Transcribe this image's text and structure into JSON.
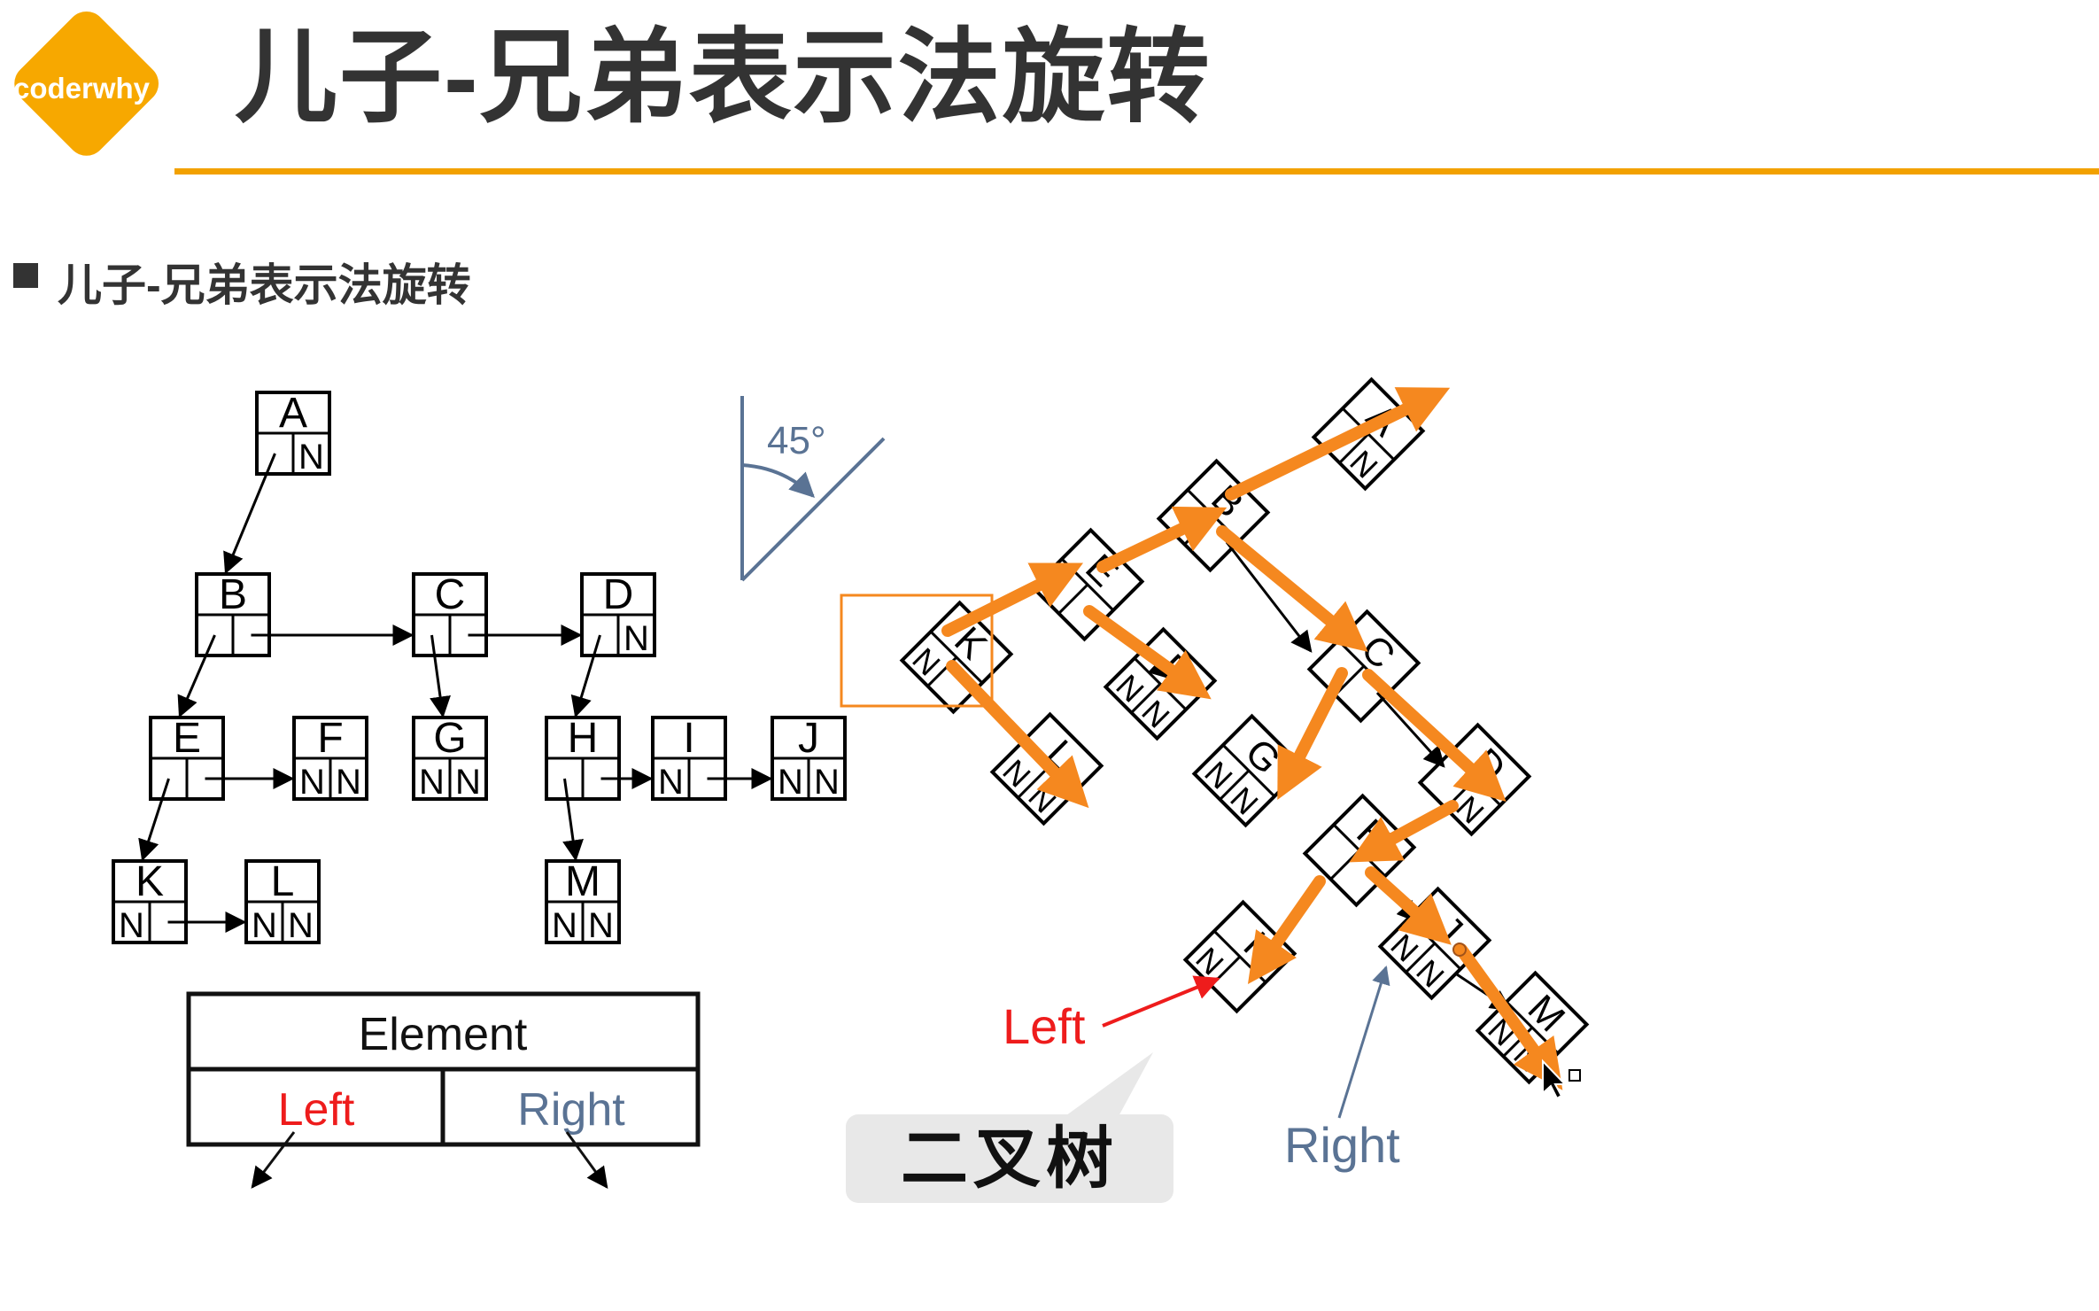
{
  "header": {
    "logo_text": "coderwhy",
    "title": "儿子-兄弟表示法旋转",
    "accent_color": "#f2a100"
  },
  "section": {
    "bullet_text": "儿子-兄弟表示法旋转"
  },
  "tree": {
    "nodes": [
      "A",
      "B",
      "C",
      "D",
      "E",
      "F",
      "G",
      "H",
      "I",
      "J",
      "K",
      "L",
      "M"
    ],
    "null_marker": "N"
  },
  "legend": {
    "element_label": "Element",
    "left_label": "Left",
    "right_label": "Right"
  },
  "rotation": {
    "angle_label": "45°"
  },
  "binary_tree": {
    "left_label": "Left",
    "right_label": "Right",
    "caption": "二叉树"
  },
  "colors": {
    "left": "#ee1c1c",
    "right": "#5a7394",
    "arrow": "#f5881f"
  }
}
